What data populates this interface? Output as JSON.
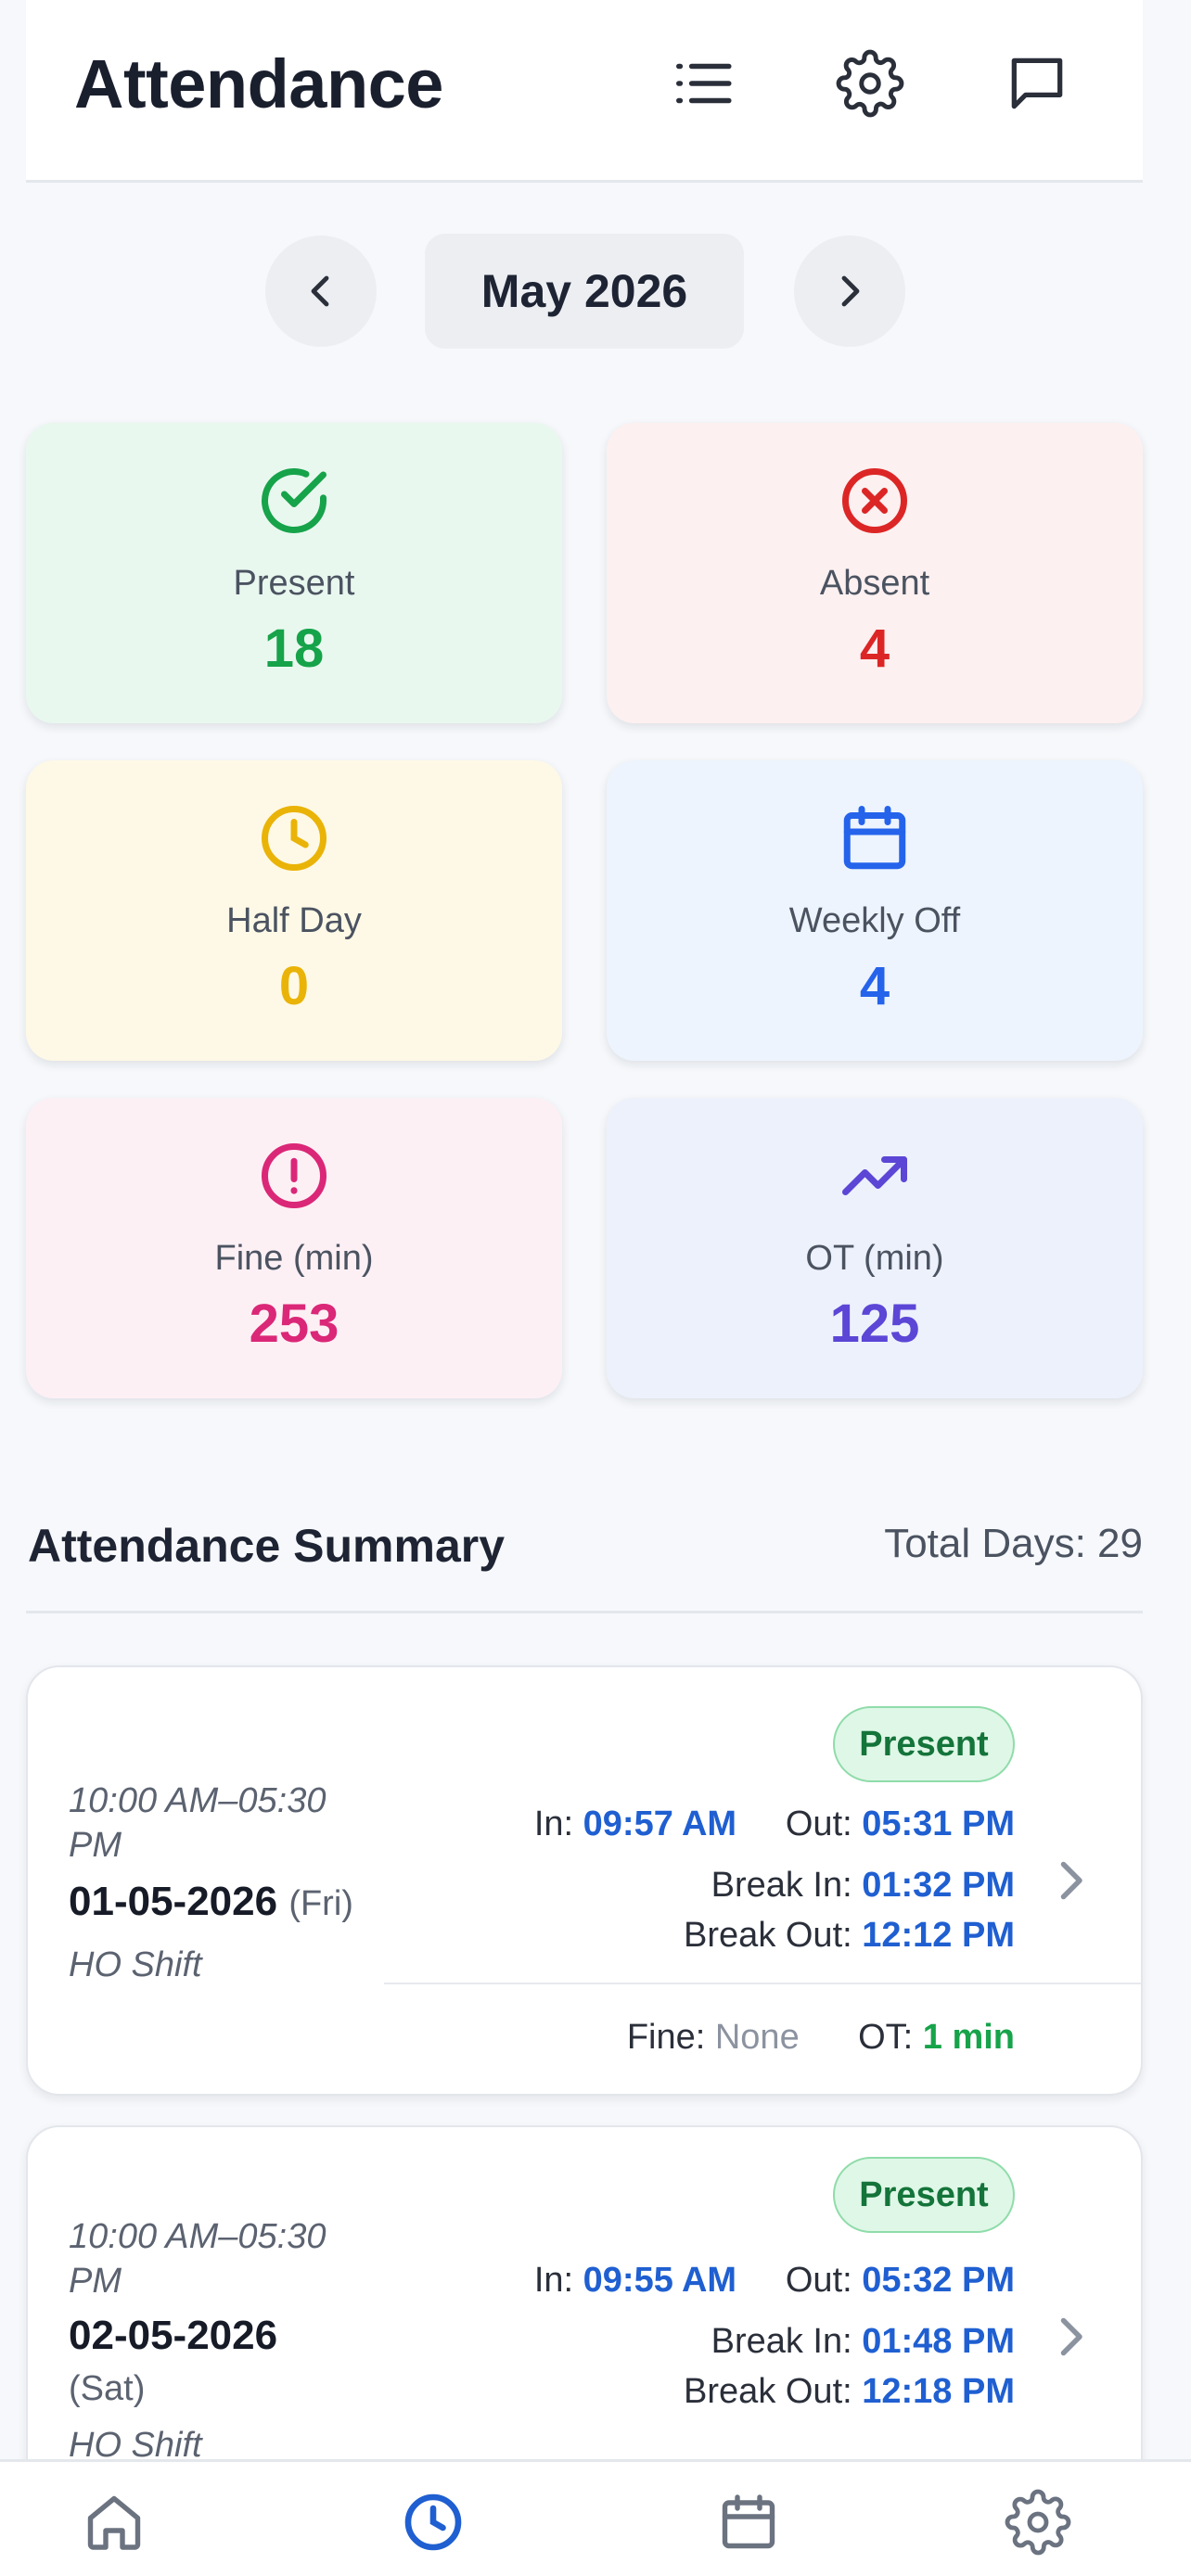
{
  "header": {
    "title": "Attendance",
    "icons": [
      "list-icon",
      "gear-icon",
      "chat-icon"
    ]
  },
  "month_nav": {
    "label": "May 2026",
    "prev_icon": "chevron-left-icon",
    "next_icon": "chevron-right-icon"
  },
  "stats": [
    {
      "label": "Present",
      "value": "18",
      "icon": "check-circle-icon",
      "color": "#16a34a",
      "bg": "#e9f8ef"
    },
    {
      "label": "Absent",
      "value": "4",
      "icon": "x-circle-icon",
      "color": "#dc2626",
      "bg": "#fdf0f0"
    },
    {
      "label": "Half Day",
      "value": "0",
      "icon": "clock-icon",
      "color": "#eab308",
      "bg": "#fef9e6"
    },
    {
      "label": "Weekly Off",
      "value": "4",
      "icon": "calendar-icon",
      "color": "#2563eb",
      "bg": "#edf4fd"
    },
    {
      "label": "Fine (min)",
      "value": "253",
      "icon": "alert-circle-icon",
      "color": "#db2777",
      "bg": "#fdf0f5"
    },
    {
      "label": "OT (min)",
      "value": "125",
      "icon": "trending-up-icon",
      "color": "#5b46d6",
      "bg": "#edf1fc"
    }
  ],
  "summary": {
    "title": "Attendance Summary",
    "total": "Total Days: 29"
  },
  "records": [
    {
      "shift_time": "10:00 AM–05:30 PM",
      "date": "01-05-2026",
      "day": "(Fri)",
      "shift_name": "HO Shift",
      "status": "Present",
      "in_label": "In:",
      "in": "09:57 AM",
      "out_label": "Out:",
      "out": "05:31 PM",
      "break_in_label": "Break In:",
      "break_in": "01:32 PM",
      "break_out_label": "Break Out:",
      "break_out": "12:12 PM",
      "fine_label": "Fine:",
      "fine": "None",
      "ot_label": "OT:",
      "ot": "1 min"
    },
    {
      "shift_time": "10:00 AM–05:30 PM",
      "date": "02-05-2026",
      "day": "(Sat)",
      "shift_name": "HO Shift",
      "status": "Present",
      "in_label": "In:",
      "in": "09:55 AM",
      "out_label": "Out:",
      "out": "05:32 PM",
      "break_in_label": "Break In:",
      "break_in": "01:48 PM",
      "break_out_label": "Break Out:",
      "break_out": "12:18 PM"
    }
  ],
  "bottom_nav": {
    "items": [
      "home-icon",
      "clock-icon",
      "calendar-icon",
      "gear-icon"
    ],
    "active_color": "#1f5fd1",
    "inactive_color": "#6b7280"
  }
}
